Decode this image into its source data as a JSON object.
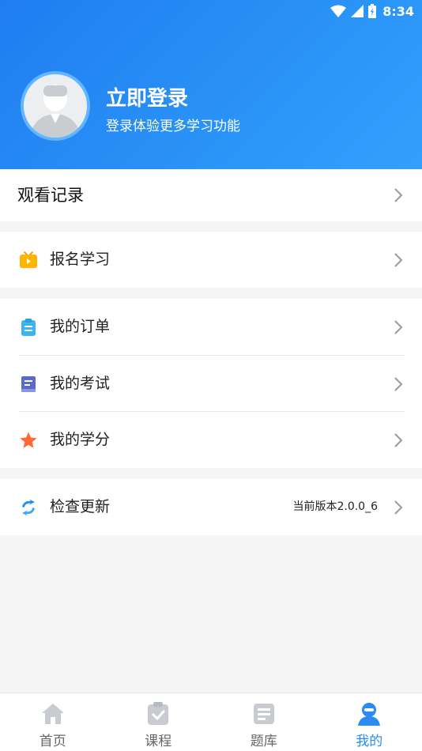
{
  "status_bar": {
    "time": "8:34",
    "icons": [
      "wifi-icon",
      "signal-icon",
      "battery-icon"
    ]
  },
  "profile": {
    "title": "立即登录",
    "subtitle": "登录体验更多学习功能"
  },
  "history": {
    "label": "观看记录"
  },
  "menu": {
    "enroll": {
      "label": "报名学习",
      "icon": "tv-icon"
    },
    "orders": {
      "label": "我的订单",
      "icon": "clipboard-icon"
    },
    "exams": {
      "label": "我的考试",
      "icon": "book-icon"
    },
    "credits": {
      "label": "我的学分",
      "icon": "star-icon"
    },
    "update": {
      "label": "检查更新",
      "icon": "refresh-icon",
      "version": "当前版本2.0.0_6"
    }
  },
  "bottom_nav": [
    {
      "label": "首页",
      "icon": "home-icon",
      "active": false
    },
    {
      "label": "课程",
      "icon": "course-icon",
      "active": false
    },
    {
      "label": "题库",
      "icon": "question-bank-icon",
      "active": false
    },
    {
      "label": "我的",
      "icon": "profile-icon",
      "active": true
    }
  ],
  "colors": {
    "accent": "#2a8cf0",
    "header_start": "#1f7df0",
    "header_end": "#34a0fb",
    "star": "#ff6a33",
    "tv": "#ffb400"
  }
}
